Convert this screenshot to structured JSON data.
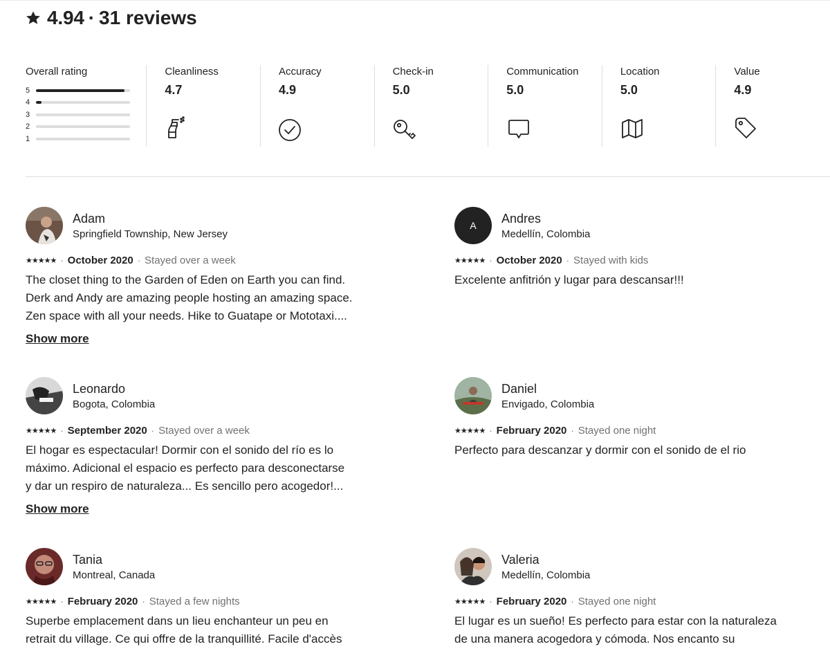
{
  "header": {
    "rating": "4.94",
    "separator": "·",
    "count": "31 reviews"
  },
  "overall": {
    "title": "Overall rating",
    "bars": [
      {
        "label": "5",
        "fraction": 0.94
      },
      {
        "label": "4",
        "fraction": 0.06
      },
      {
        "label": "3",
        "fraction": 0
      },
      {
        "label": "2",
        "fraction": 0
      },
      {
        "label": "1",
        "fraction": 0
      }
    ]
  },
  "categories": [
    {
      "name": "Cleanliness",
      "score": "4.7",
      "icon": "spray-bottle-icon"
    },
    {
      "name": "Accuracy",
      "score": "4.9",
      "icon": "check-circle-icon"
    },
    {
      "name": "Check-in",
      "score": "5.0",
      "icon": "key-icon"
    },
    {
      "name": "Communication",
      "score": "5.0",
      "icon": "chat-bubble-icon"
    },
    {
      "name": "Location",
      "score": "5.0",
      "icon": "map-icon"
    },
    {
      "name": "Value",
      "score": "4.9",
      "icon": "price-tag-icon"
    }
  ],
  "reviews": [
    {
      "name": "Adam",
      "location": "Springfield Township, New Jersey",
      "stars": "★★★★★",
      "date": "October 2020",
      "stay": "Stayed over a week",
      "text": "The closet thing to the Garden of Eden on Earth you can find.\nDerk and Andy are amazing people hosting an amazing space.\nZen space with all your needs. Hike to Guatape or Mototaxi....",
      "show_more": "Show more",
      "avatar": "photo"
    },
    {
      "name": "Andres",
      "location": "Medellín, Colombia",
      "stars": "★★★★★",
      "date": "October 2020",
      "stay": "Stayed with kids",
      "text": "Excelente anfitrión y lugar para descansar!!!",
      "show_more": "",
      "avatar": "initial",
      "initial": "A"
    },
    {
      "name": "Leonardo",
      "location": "Bogota, Colombia",
      "stars": "★★★★★",
      "date": "September 2020",
      "stay": "Stayed over a week",
      "text": "El hogar es espectacular! Dormir con el sonido del río es lo\nmáximo. Adicional el espacio es perfecto para desconectarse\ny dar un respiro de naturaleza... Es sencillo pero acogedor!...",
      "show_more": "Show more",
      "avatar": "photo"
    },
    {
      "name": "Daniel",
      "location": "Envigado, Colombia",
      "stars": "★★★★★",
      "date": "February 2020",
      "stay": "Stayed one night",
      "text": "Perfecto para descanzar y dormir con el sonido de el rio",
      "show_more": "",
      "avatar": "photo"
    },
    {
      "name": "Tania",
      "location": "Montreal, Canada",
      "stars": "★★★★★",
      "date": "February 2020",
      "stay": "Stayed a few nights",
      "text": "Superbe emplacement dans un lieu enchanteur un peu en\nretrait du village. Ce qui offre de la tranquillité. Facile d'accès",
      "show_more": "",
      "avatar": "photo"
    },
    {
      "name": "Valeria",
      "location": "Medellín, Colombia",
      "stars": "★★★★★",
      "date": "February 2020",
      "stay": "Stayed one night",
      "text": "El lugar es un sueño! Es perfecto para estar con la naturaleza\nde una manera acogedora y cómoda. Nos encanto su",
      "show_more": "",
      "avatar": "photo"
    }
  ],
  "colors": {
    "text": "#222222",
    "muted": "#717171",
    "divider": "#dddddd",
    "bar_track": "#dddddd"
  }
}
